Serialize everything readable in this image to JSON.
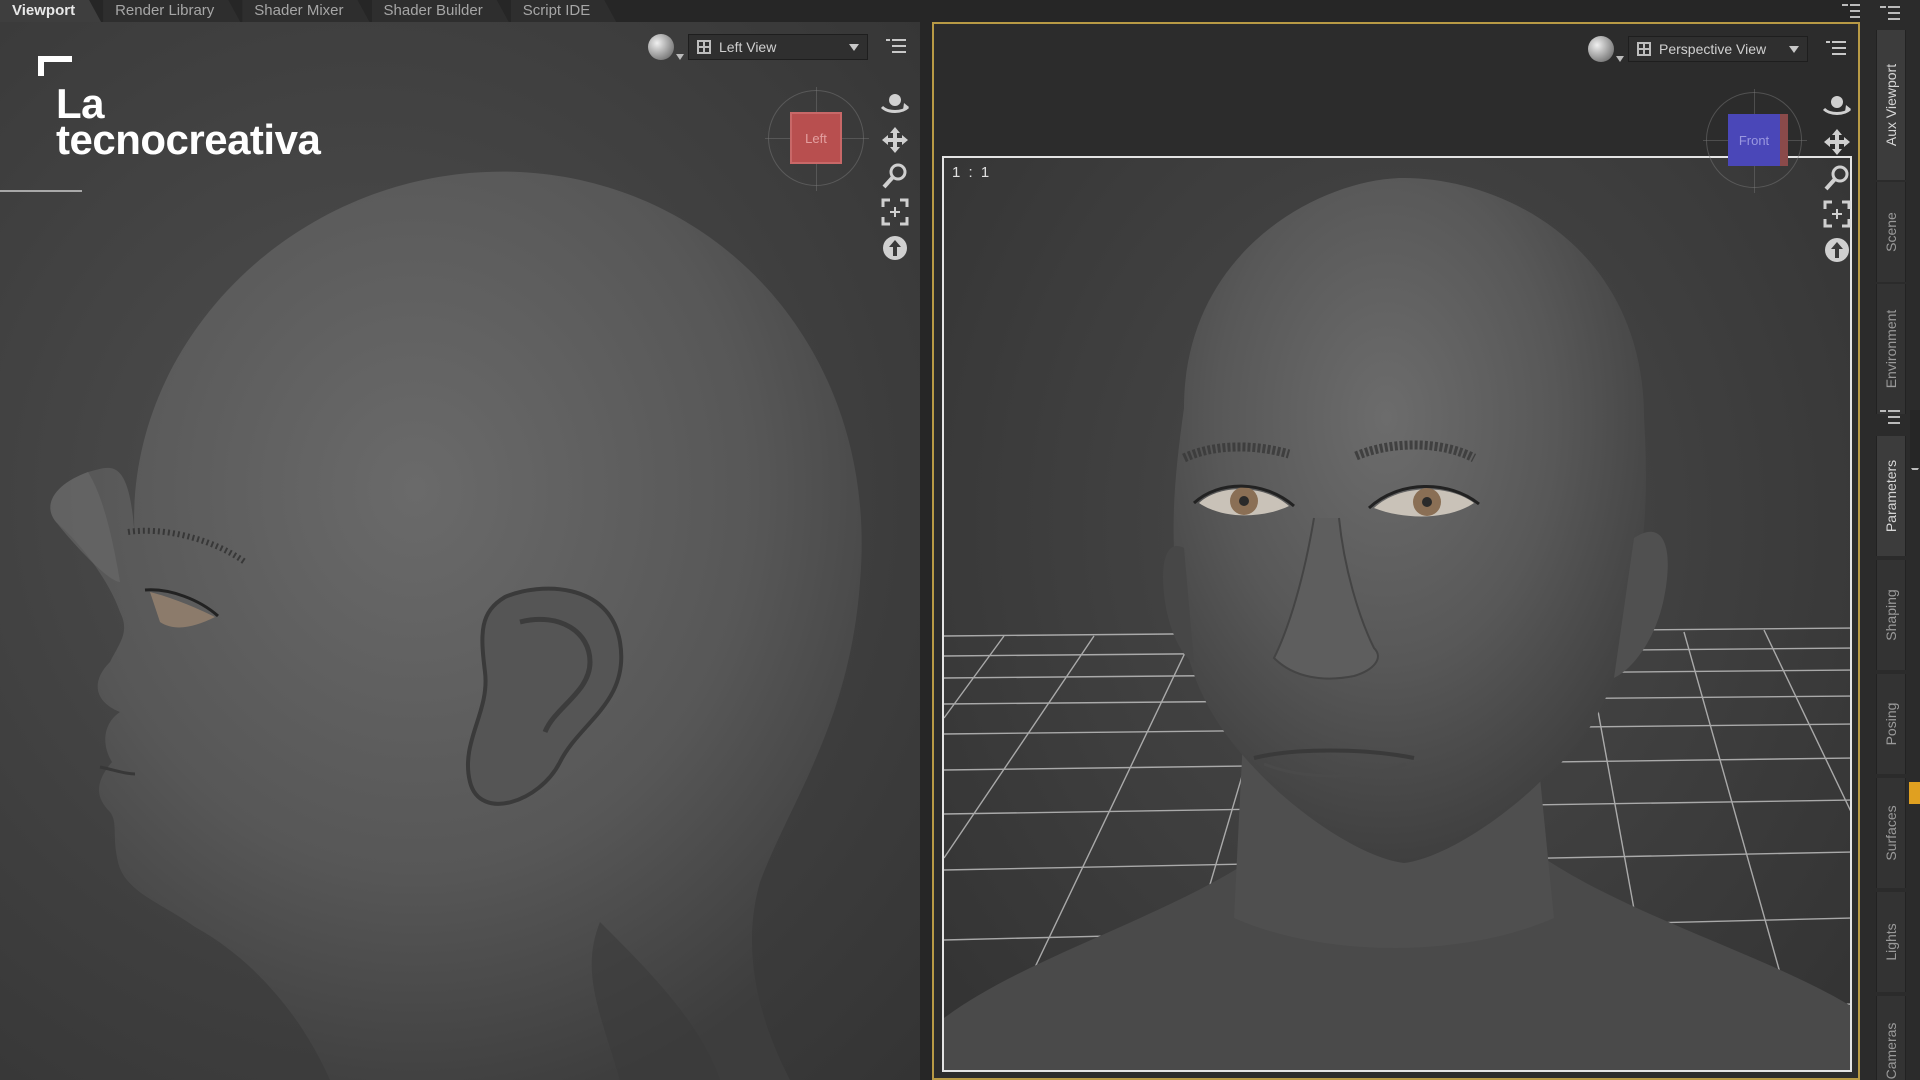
{
  "tabs": [
    {
      "label": "Viewport",
      "active": true
    },
    {
      "label": "Render Library",
      "active": false
    },
    {
      "label": "Shader Mixer",
      "active": false
    },
    {
      "label": "Shader Builder",
      "active": false
    },
    {
      "label": "Script IDE",
      "active": false
    }
  ],
  "brand": {
    "line1": "La",
    "line2": "tecnocreativa"
  },
  "left_view": {
    "selected_view": "Left View",
    "cube_face": "Left",
    "cube_color": "#b84f4f"
  },
  "right_view": {
    "selected_view": "Perspective View",
    "cube_face": "Front",
    "cube_color": "#4a47b8",
    "frame_ratio": "1 : 1",
    "active_border_color": "#b89a45"
  },
  "nav_icons": [
    "orbit-icon",
    "pan-icon",
    "zoom-icon",
    "frame-icon",
    "reset-view-icon"
  ],
  "side_tabs_top": [
    {
      "label": "Aux Viewport",
      "active": true
    },
    {
      "label": "Scene",
      "active": false
    },
    {
      "label": "Environment",
      "active": false
    }
  ],
  "side_tabs_bottom": [
    {
      "label": "Parameters",
      "active": true
    },
    {
      "label": "Shaping",
      "active": false
    },
    {
      "label": "Posing",
      "active": false
    },
    {
      "label": "Surfaces",
      "active": false
    },
    {
      "label": "Lights",
      "active": false
    },
    {
      "label": "Cameras",
      "active": false
    }
  ],
  "colors": {
    "accent_yellow": "#e0a020",
    "panel_bg": "#2b2b2b",
    "model_gray": "#5c5c5c"
  }
}
